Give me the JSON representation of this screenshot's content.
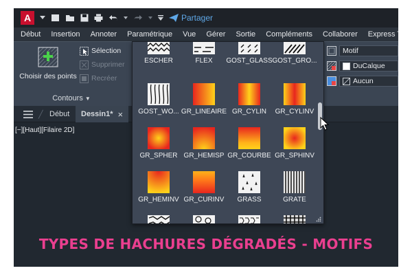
{
  "titlebar": {
    "app_logo": "A",
    "share_label": "Partager",
    "icons": [
      "chevron-down-icon",
      "new-file-icon",
      "open-folder-icon",
      "save-icon",
      "print-icon",
      "undo-icon",
      "redo-icon",
      "customize-icon",
      "share-icon"
    ]
  },
  "menubar": {
    "items": [
      "Début",
      "Insertion",
      "Annoter",
      "Paramétrique",
      "Vue",
      "Gérer",
      "Sortie",
      "Compléments",
      "Collaborer",
      "Express T"
    ]
  },
  "ribbon": {
    "contours": {
      "choose_points": "Choisir des points",
      "selection": "Sélection",
      "delete": "Supprimer",
      "recreate": "Recréer",
      "panel_title": "Contours"
    },
    "properties": {
      "pattern_type": "Motif",
      "color": "DuCalque",
      "background": "Aucun"
    }
  },
  "tabs": {
    "menu_icon": "hamburger-menu-icon",
    "start": "Début",
    "drawing": "Dessin1*",
    "close": "×"
  },
  "viewport": {
    "label": "[−][Haut][Filaire 2D]"
  },
  "gallery": {
    "rows": [
      [
        "ESCHER",
        "FLEX",
        "GOST_GLASS",
        "GOST_GRO..."
      ],
      [
        "GOST_WO...",
        "GR_LINEAIRE",
        "GR_CYLIN",
        "GR_CYLINV"
      ],
      [
        "GR_SPHER",
        "GR_HEMISP",
        "GR_COURBE",
        "GR_SPHINV"
      ],
      [
        "GR_HEMINV",
        "GR_CURINV",
        "GRASS",
        "GRATE"
      ]
    ]
  },
  "caption": "TYPES DE HACHURES DÉGRADÉS - MOTIFS",
  "colors": {
    "caption": "#ea3f8f",
    "gradient_red": "#e8261e",
    "gradient_yellow": "#ffd21a",
    "app_red": "#c8102e",
    "share_blue": "#5fa8e8"
  }
}
